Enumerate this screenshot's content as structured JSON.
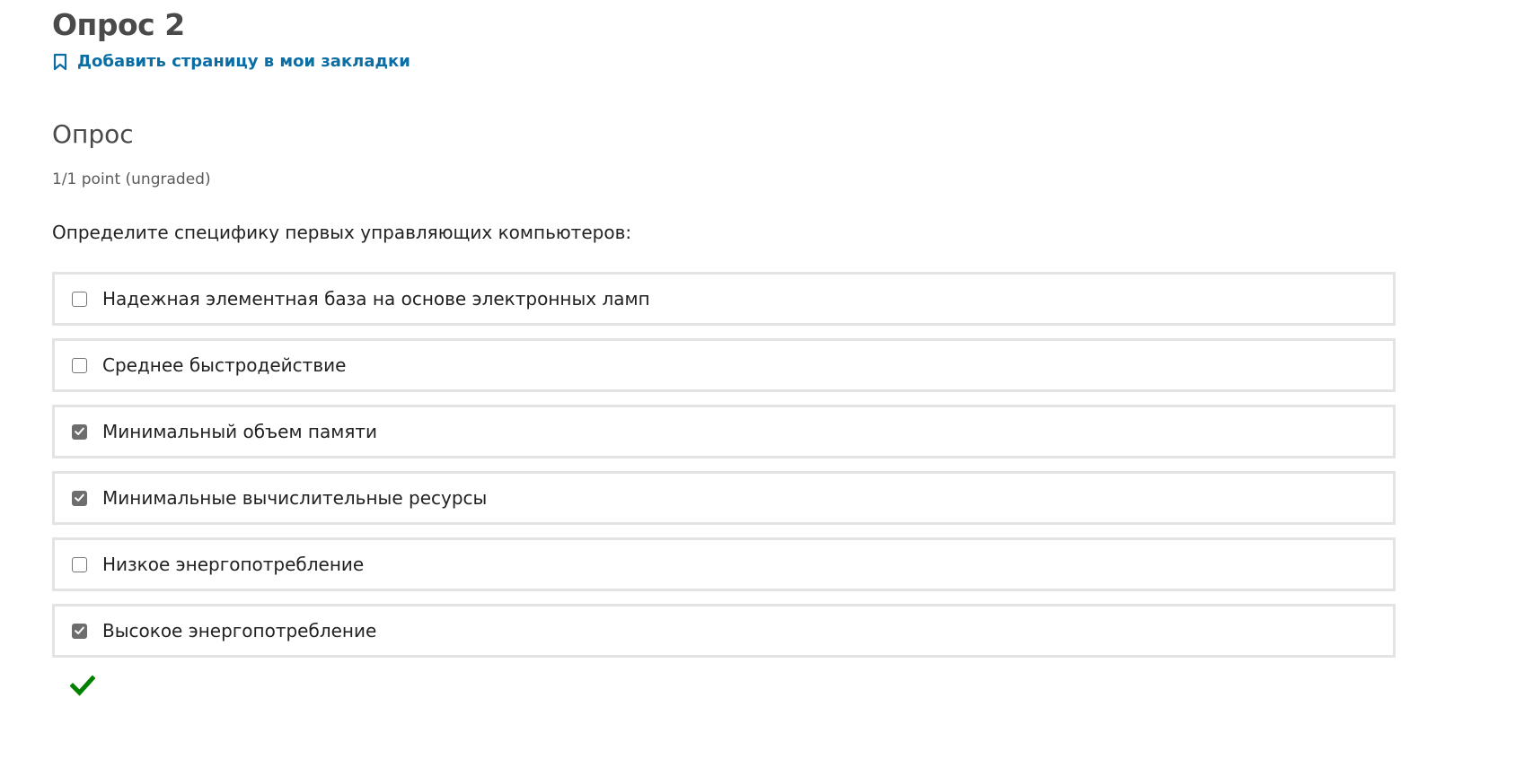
{
  "unit": {
    "title": "Опрос 2",
    "bookmark_label": "Добавить страницу в мои закладки",
    "bookmark_icon": "bookmark-icon"
  },
  "problem": {
    "title": "Опрос",
    "points": "1/1 point (ungraded)",
    "question": "Определите специфику первых управляющих компьютеров:",
    "choices": [
      {
        "label": "Надежная элементная база на основе электронных ламп",
        "checked": false
      },
      {
        "label": "Среднее быстродействие",
        "checked": false
      },
      {
        "label": "Минимальный объем памяти",
        "checked": true
      },
      {
        "label": "Минимальные вычислительные ресурсы",
        "checked": true
      },
      {
        "label": "Низкое энергопотребление",
        "checked": false
      },
      {
        "label": "Высокое энергопотребление",
        "checked": true
      }
    ],
    "result": {
      "icon": "checkmark-icon",
      "status": "correct",
      "color": "#008100"
    }
  },
  "colors": {
    "link": "#0a6ea4",
    "choice_border": "#e3e3e3",
    "checkbox_checked": "#6d6d6d",
    "correct": "#008100"
  }
}
